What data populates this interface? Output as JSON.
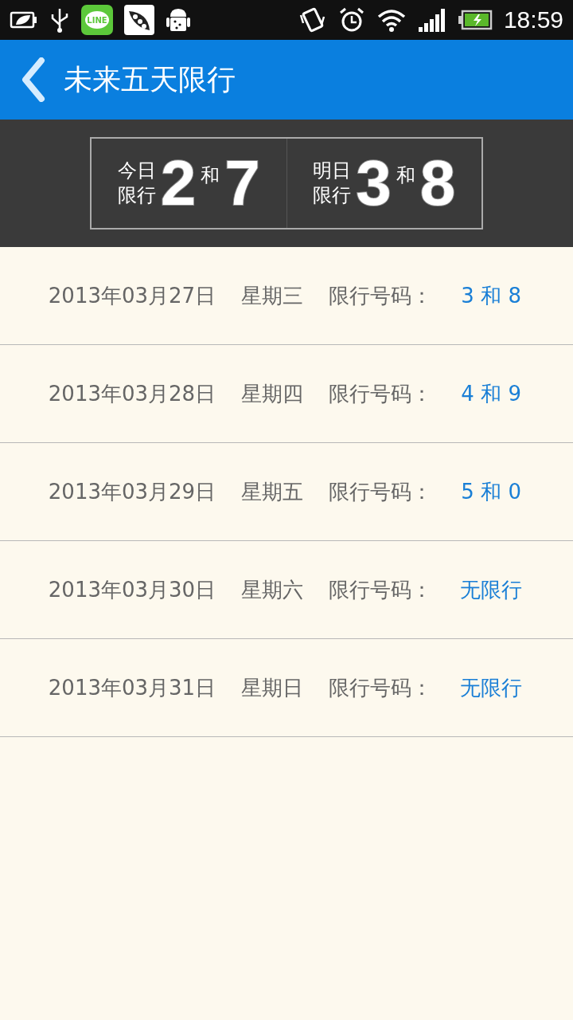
{
  "status_bar": {
    "app_icon_label": "LINE",
    "time": "18:59"
  },
  "header": {
    "title": "未来五天限行"
  },
  "banner": {
    "today": {
      "label_line1": "今日",
      "label_line2": "限行",
      "first": "2",
      "joiner": "和",
      "second": "7"
    },
    "tomorrow": {
      "label_line1": "明日",
      "label_line2": "限行",
      "first": "3",
      "joiner": "和",
      "second": "8"
    }
  },
  "rows": [
    {
      "date": "2013年03月27日",
      "weekday": "星期三",
      "label": "限行号码：",
      "value": "3 和 8"
    },
    {
      "date": "2013年03月28日",
      "weekday": "星期四",
      "label": "限行号码：",
      "value": "4 和 9"
    },
    {
      "date": "2013年03月29日",
      "weekday": "星期五",
      "label": "限行号码：",
      "value": "5 和 0"
    },
    {
      "date": "2013年03月30日",
      "weekday": "星期六",
      "label": "限行号码：",
      "value": "无限行"
    },
    {
      "date": "2013年03月31日",
      "weekday": "星期日",
      "label": "限行号码：",
      "value": "无限行"
    }
  ]
}
